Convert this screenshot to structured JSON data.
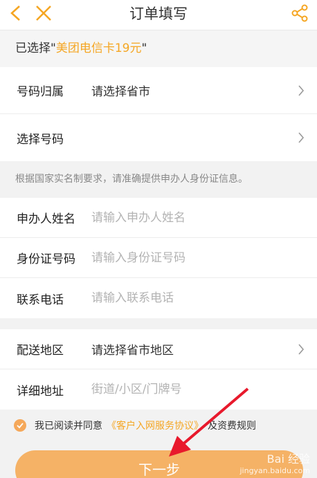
{
  "header": {
    "title": "订单填写"
  },
  "selected": {
    "prefix": "已选择\"",
    "product": "美团电信卡19元",
    "suffix": "\""
  },
  "group1": [
    {
      "label": "号码归属",
      "value": "请选择省市"
    },
    {
      "label": "选择号码",
      "value": ""
    }
  ],
  "notice": "根据国家实名制要求，请准确提供申办人身份证信息。",
  "group2": [
    {
      "label": "申办人姓名",
      "placeholder": "请输入申办人姓名"
    },
    {
      "label": "身份证号码",
      "placeholder": "请输入身份证号码"
    },
    {
      "label": "联系电话",
      "placeholder": "请输入联系电话"
    }
  ],
  "group3": [
    {
      "label": "配送地区",
      "value": "请选择省市地区"
    },
    {
      "label": "详细地址",
      "placeholder": "街道/小区/门牌号"
    }
  ],
  "agree": {
    "text_before": "我已阅读并同意",
    "link": "《客户入网服务协议》",
    "text_after": "及资费规则"
  },
  "next_button": "下一步",
  "watermark": {
    "brand": "Bai 经验",
    "url": "jingyan.baidu.com"
  },
  "colors": {
    "accent": "#f5a623",
    "button": "#f5b266",
    "arrow": "#e8192c"
  }
}
